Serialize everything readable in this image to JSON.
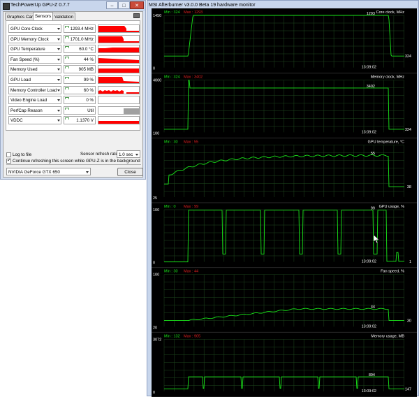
{
  "gpuz": {
    "title": "TechPowerUp GPU-Z 0.7.7",
    "tabs": [
      "Graphics Card",
      "Sensors",
      "Validation"
    ],
    "active_tab": 1,
    "sensors": [
      {
        "label": "GPU Core Clock",
        "value": "1293.4 MHz"
      },
      {
        "label": "GPU Memory Clock",
        "value": "1701.0 MHz"
      },
      {
        "label": "GPU Temperature",
        "value": "60.0 °C"
      },
      {
        "label": "Fan Speed (%)",
        "value": "44 %"
      },
      {
        "label": "Memory Used",
        "value": "905 MB"
      },
      {
        "label": "GPU Load",
        "value": "99 %"
      },
      {
        "label": "Memory Controller Load",
        "value": "60 %"
      },
      {
        "label": "Video Engine Load",
        "value": "0 %"
      },
      {
        "label": "PerfCap Reason",
        "value": "Util"
      },
      {
        "label": "VDDC",
        "value": "1.1370 V"
      }
    ],
    "log_to_file": "Log to file",
    "continue_refresh": "Continue refreshing this screen while GPU-Z is in the background",
    "refresh_rate_label": "Sensor refresh rate:",
    "refresh_rate_value": "1.0 sec",
    "gpu_name": "NVIDIA GeForce GTX 650",
    "close_label": "Close",
    "graph_color": "#ff0000"
  },
  "afterburner": {
    "title": "MSI Afterburner v3.0.0 Beta 19 hardware monitor",
    "line_color": "#19e619",
    "grid_color": "#1f4a1f",
    "graphs": [
      {
        "name": "Core clock, MHz",
        "min_label": "Min : 324",
        "max_label": "Max : 1293",
        "ymax": "1450",
        "ymin": "0",
        "cur_value": "1293",
        "end_value": "324",
        "time": "13:09:02"
      },
      {
        "name": "Memory clock, MHz",
        "min_label": "Min : 324",
        "max_label": "Max : 3402",
        "ymax": "4000",
        "ymin": "100",
        "cur_value": "3402",
        "end_value": "324",
        "time": "13:09:02"
      },
      {
        "name": "GPU temperature, °C",
        "min_label": "Min : 30",
        "max_label": "Max : 55",
        "ymax": "",
        "ymin": "25",
        "cur_value": "55",
        "end_value": "38",
        "time": ""
      },
      {
        "name": "GPU usage, %",
        "min_label": "Min : 0",
        "max_label": "Max : 99",
        "ymax": "100",
        "ymin": "0",
        "cur_value": "99",
        "end_value": "1",
        "time": "13:09:02"
      },
      {
        "name": "Fan speed, %",
        "min_label": "Min : 30",
        "max_label": "Max : 44",
        "ymax": "100",
        "ymin": "20",
        "cur_value": "44",
        "end_value": "30",
        "time": "13:09:02"
      },
      {
        "name": "Memory usage, MB",
        "min_label": "Min : 132",
        "max_label": "Max : 905",
        "ymax": "3072",
        "ymin": "0",
        "cur_value": "894",
        "end_value": "147",
        "time": "13:09:02"
      }
    ]
  }
}
